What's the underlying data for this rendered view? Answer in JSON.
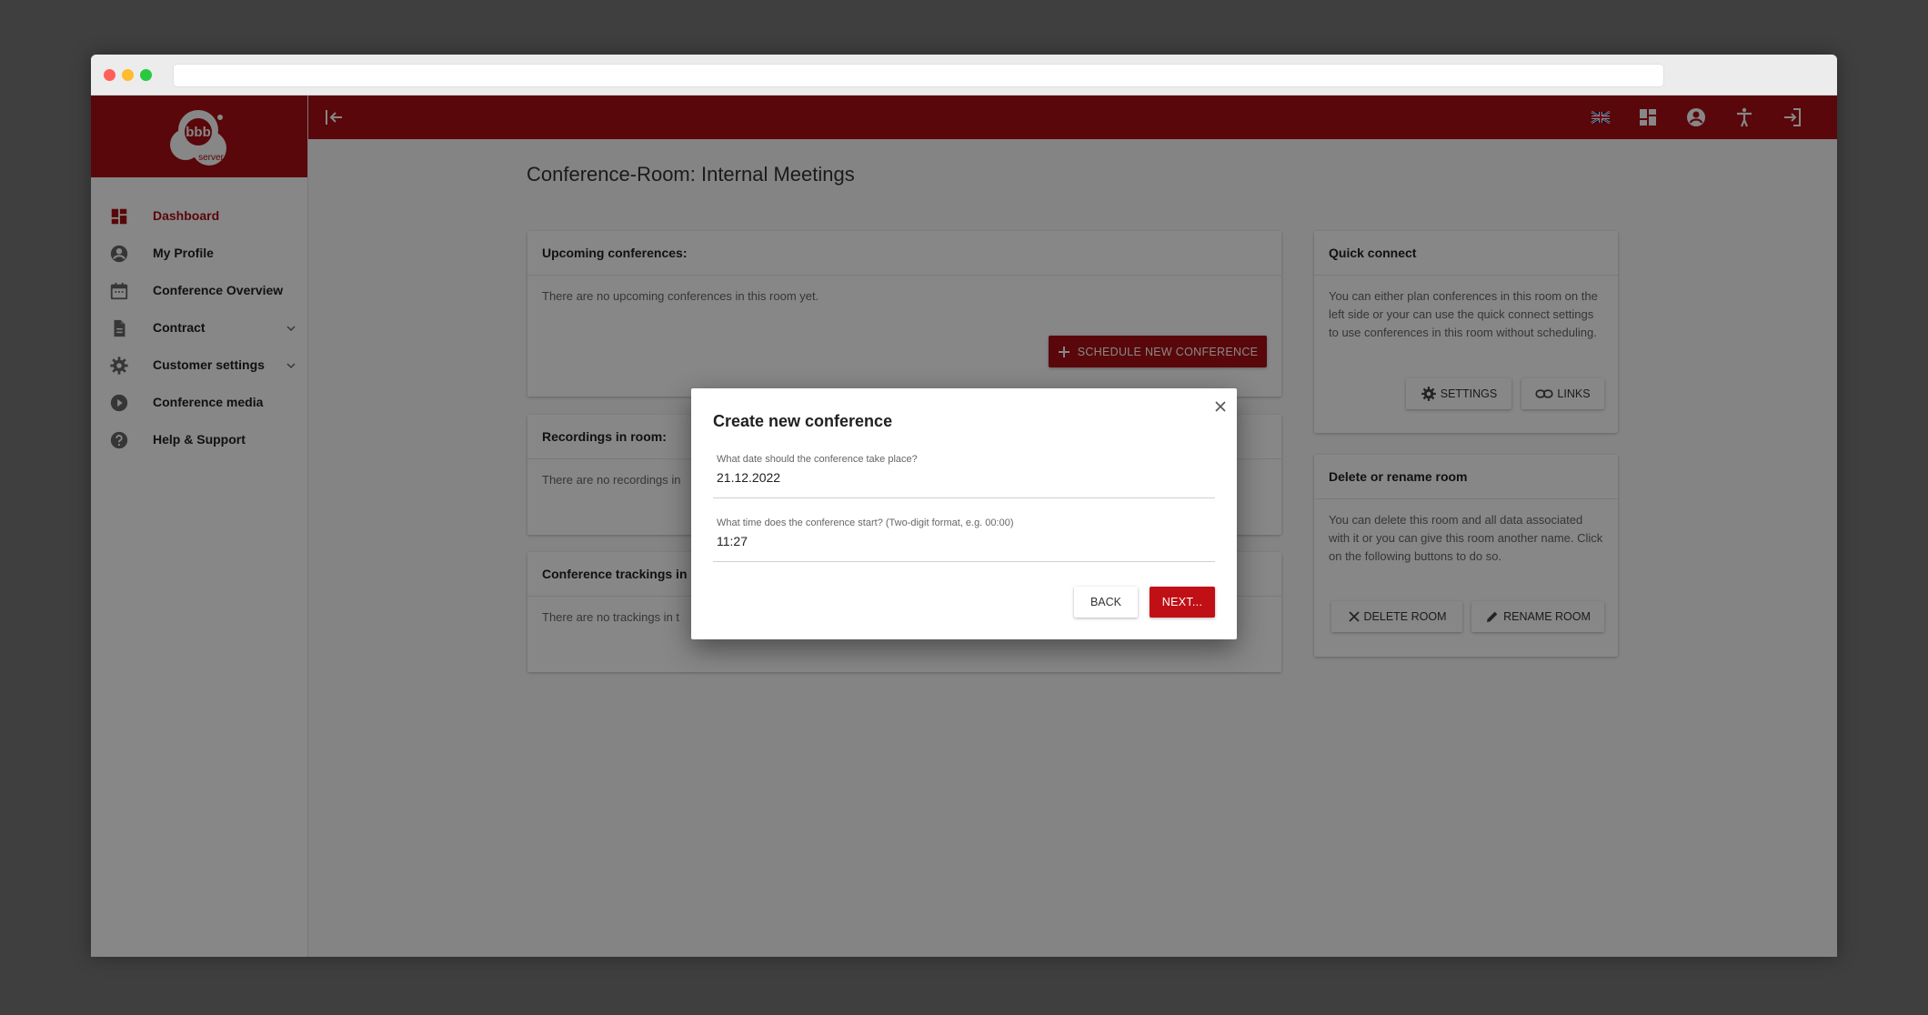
{
  "app": {
    "logo_text": "bbb",
    "logo_sub": "server"
  },
  "sidebar": {
    "items": [
      {
        "label": "Dashboard",
        "icon": "dashboard-icon"
      },
      {
        "label": "My Profile",
        "icon": "account-circle-icon"
      },
      {
        "label": "Conference Overview",
        "icon": "calendar-icon"
      },
      {
        "label": "Contract",
        "icon": "document-icon"
      },
      {
        "label": "Customer settings",
        "icon": "gear-icon"
      },
      {
        "label": "Conference media",
        "icon": "play-circle-icon"
      },
      {
        "label": "Help & Support",
        "icon": "help-circle-icon"
      }
    ]
  },
  "page": {
    "title": "Conference-Room: Internal Meetings"
  },
  "upcoming": {
    "header": "Upcoming conferences:",
    "body": "There are no upcoming conferences in this room yet.",
    "schedule_button": "SCHEDULE NEW CONFERENCE"
  },
  "recordings": {
    "header": "Recordings in room:",
    "body": "There are no recordings in"
  },
  "trackings": {
    "header": "Conference trackings in",
    "body": "There are no trackings in t"
  },
  "quick_connect": {
    "header": "Quick connect",
    "body": "You can either plan conferences in this room on the left side or your can use the quick connect settings to use conferences in this room without scheduling.",
    "settings_button": "SETTINGS",
    "links_button": "LINKS"
  },
  "delete_rename": {
    "header": "Delete or rename room",
    "body": "You can delete this room and all data associated with it or you can give this room another name. Click on the following buttons to do so.",
    "delete_button": "DELETE ROOM",
    "rename_button": "RENAME ROOM"
  },
  "dialog": {
    "title": "Create new conference",
    "date_label": "What date should the conference take place?",
    "date_value": "21.12.2022",
    "time_label": "What time does the conference start? (Two-digit format, e.g. 00:00)",
    "time_value": "11:27",
    "back_button": "BACK",
    "next_button": "NEXT..."
  },
  "colors": {
    "brand": "#a80f14",
    "overlay": "#000000"
  }
}
